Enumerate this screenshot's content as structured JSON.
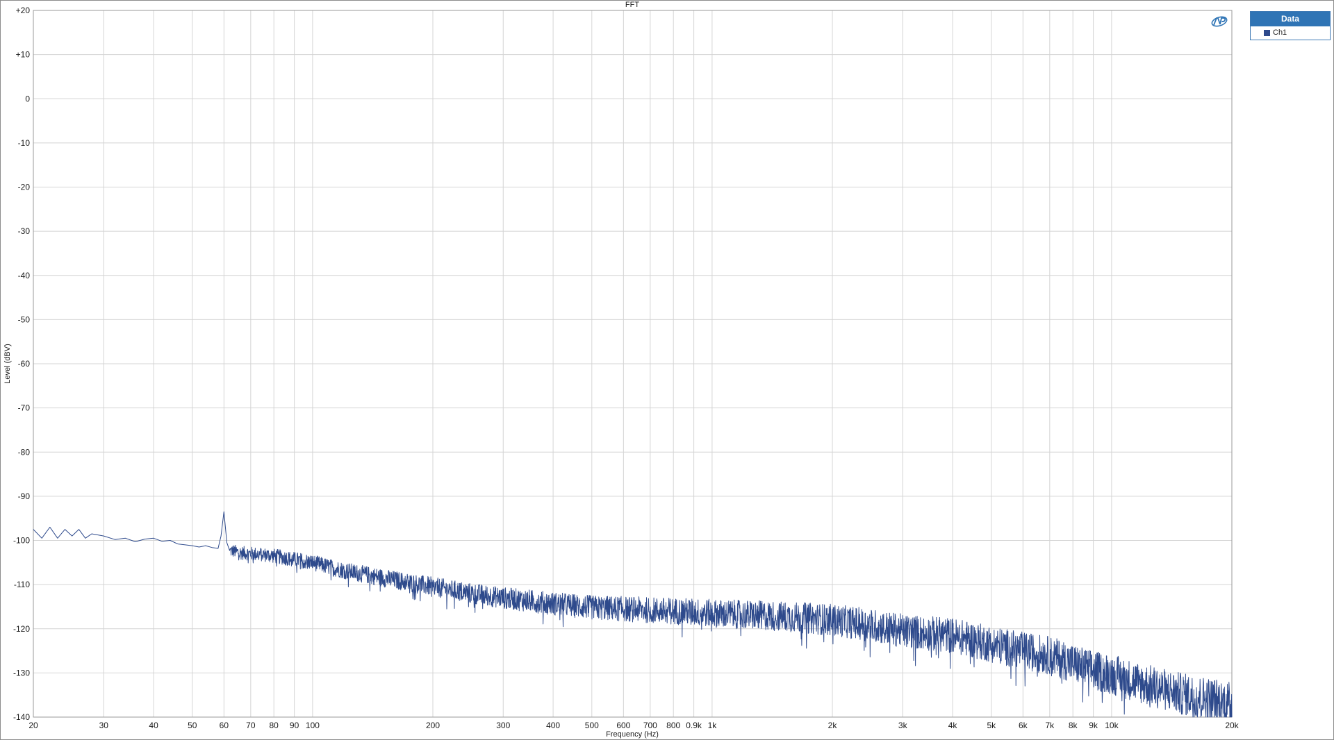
{
  "colors": {
    "series": "#2e4a8c",
    "grid": "#d4d4d4",
    "axis": "#9a9a9a",
    "tick_text": "#1a1a1a",
    "legend_header": "#2f74b5"
  },
  "chart_data": {
    "type": "line",
    "title": "FFT",
    "xlabel": "Frequency (Hz)",
    "ylabel": "Level (dBV)",
    "xscale": "log",
    "xlim": [
      20,
      20000
    ],
    "ylim": [
      -140,
      20
    ],
    "grid": true,
    "legend_position": "top-right, outside plot",
    "x_ticks": [
      {
        "value": 20,
        "label": "20"
      },
      {
        "value": 30,
        "label": "30"
      },
      {
        "value": 40,
        "label": "40"
      },
      {
        "value": 50,
        "label": "50"
      },
      {
        "value": 60,
        "label": "60"
      },
      {
        "value": 70,
        "label": "70"
      },
      {
        "value": 80,
        "label": "80"
      },
      {
        "value": 90,
        "label": "90"
      },
      {
        "value": 100,
        "label": "100"
      },
      {
        "value": 200,
        "label": "200"
      },
      {
        "value": 300,
        "label": "300"
      },
      {
        "value": 400,
        "label": "400"
      },
      {
        "value": 500,
        "label": "500"
      },
      {
        "value": 600,
        "label": "600"
      },
      {
        "value": 700,
        "label": "700"
      },
      {
        "value": 800,
        "label": "800"
      },
      {
        "value": 900,
        "label": "0.9k"
      },
      {
        "value": 1000,
        "label": "1k"
      },
      {
        "value": 2000,
        "label": "2k"
      },
      {
        "value": 3000,
        "label": "3k"
      },
      {
        "value": 4000,
        "label": "4k"
      },
      {
        "value": 5000,
        "label": "5k"
      },
      {
        "value": 6000,
        "label": "6k"
      },
      {
        "value": 7000,
        "label": "7k"
      },
      {
        "value": 8000,
        "label": "8k"
      },
      {
        "value": 9000,
        "label": "9k"
      },
      {
        "value": 10000,
        "label": "10k"
      },
      {
        "value": 20000,
        "label": "20k"
      }
    ],
    "y_ticks": [
      {
        "value": 20,
        "label": "+20"
      },
      {
        "value": 10,
        "label": "+10"
      },
      {
        "value": 0,
        "label": "0"
      },
      {
        "value": -10,
        "label": "-10"
      },
      {
        "value": -20,
        "label": "-20"
      },
      {
        "value": -30,
        "label": "-30"
      },
      {
        "value": -40,
        "label": "-40"
      },
      {
        "value": -50,
        "label": "-50"
      },
      {
        "value": -60,
        "label": "-60"
      },
      {
        "value": -70,
        "label": "-70"
      },
      {
        "value": -80,
        "label": "-80"
      },
      {
        "value": -90,
        "label": "-90"
      },
      {
        "value": -100,
        "label": "-100"
      },
      {
        "value": -110,
        "label": "-110"
      },
      {
        "value": -120,
        "label": "-120"
      },
      {
        "value": -130,
        "label": "-130"
      },
      {
        "value": -140,
        "label": "-140"
      }
    ],
    "series": [
      {
        "name": "Ch1",
        "x": [
          20,
          21,
          22,
          23,
          24,
          25,
          26,
          27,
          28,
          30,
          32,
          34,
          36,
          38,
          40,
          42,
          44,
          46,
          48,
          50,
          52,
          54,
          56,
          58,
          59,
          60,
          61,
          62,
          64,
          66,
          70,
          75,
          80,
          90,
          100,
          110,
          120,
          150,
          200,
          250,
          300,
          400,
          500,
          600,
          700,
          800,
          900,
          1000,
          1500,
          2000,
          2500,
          3000,
          4000,
          5000,
          6000,
          7000,
          8000,
          9000,
          10000,
          12000,
          15000,
          18000,
          20000
        ],
        "y": [
          -97.5,
          -99.5,
          -97,
          -99.5,
          -97.5,
          -99,
          -97.5,
          -99.5,
          -98.5,
          -99,
          -99.8,
          -99.5,
          -100.3,
          -99.7,
          -99.5,
          -100.2,
          -100,
          -100.8,
          -101,
          -101.2,
          -101.5,
          -101.2,
          -101.6,
          -101.8,
          -99,
          -93.5,
          -100.5,
          -102.3,
          -102.5,
          -102.8,
          -103,
          -103.2,
          -103.5,
          -104.3,
          -105,
          -106,
          -106.8,
          -108.5,
          -110.5,
          -112,
          -113,
          -114.3,
          -115.2,
          -115.5,
          -115.8,
          -116,
          -116.2,
          -116.5,
          -117.2,
          -118,
          -119.2,
          -120.5,
          -121.5,
          -123.5,
          -125,
          -126,
          -127.8,
          -129.5,
          -130.3,
          -132.5,
          -134.8,
          -136,
          -137
        ]
      }
    ]
  }
}
